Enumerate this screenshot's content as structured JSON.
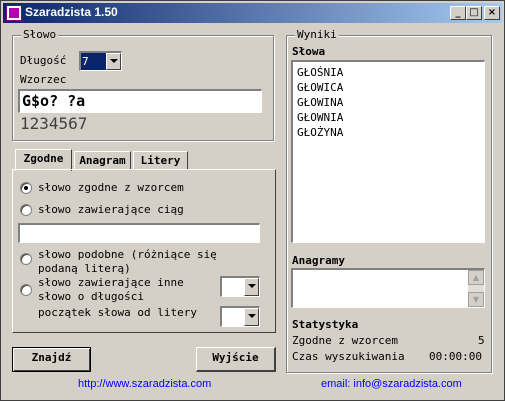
{
  "window": {
    "title": "Szaradzista 1.50",
    "minimize": "_",
    "maximize": "□",
    "close": "×"
  },
  "slowo": {
    "legend": "Słowo",
    "length_label": "Długość",
    "length_value": "7",
    "pattern_label": "Wzorzec",
    "pattern_value": "G$o? ?a",
    "digits": "1234567"
  },
  "tabs": [
    "Zgodne",
    "Anagram",
    "Litery"
  ],
  "options": [
    {
      "label": "słowo zgodne z wzorcem",
      "selected": true
    },
    {
      "label": "słowo zawierające ciąg",
      "selected": false
    },
    {
      "label_line1": "słowo podobne (różniące się",
      "label_line2": "podaną literą)",
      "selected": false
    },
    {
      "label_line1": "słowo zawierające inne",
      "label_line2": "słowo o długości",
      "selected": false
    }
  ],
  "start_letter_label": "początek słowa od litery",
  "buttons": {
    "find": "Znajdź",
    "exit": "Wyjście"
  },
  "wyniki": {
    "legend": "Wyniki",
    "words_label": "Słowa",
    "words": [
      "GŁOŚNIA",
      "GŁOWICA",
      "GŁOWINA",
      "GŁOWNIA",
      "GŁOŻYNA"
    ],
    "anagrams_label": "Anagramy",
    "stats_label": "Statystyka",
    "stats": [
      {
        "label": "Zgodne z wzorcem",
        "value": "5"
      },
      {
        "label": "Czas wyszukiwania",
        "value": "00:00:00"
      }
    ]
  },
  "footer": {
    "url": "http://www.szaradzista.com",
    "email": "email: info@szaradzista.com"
  }
}
